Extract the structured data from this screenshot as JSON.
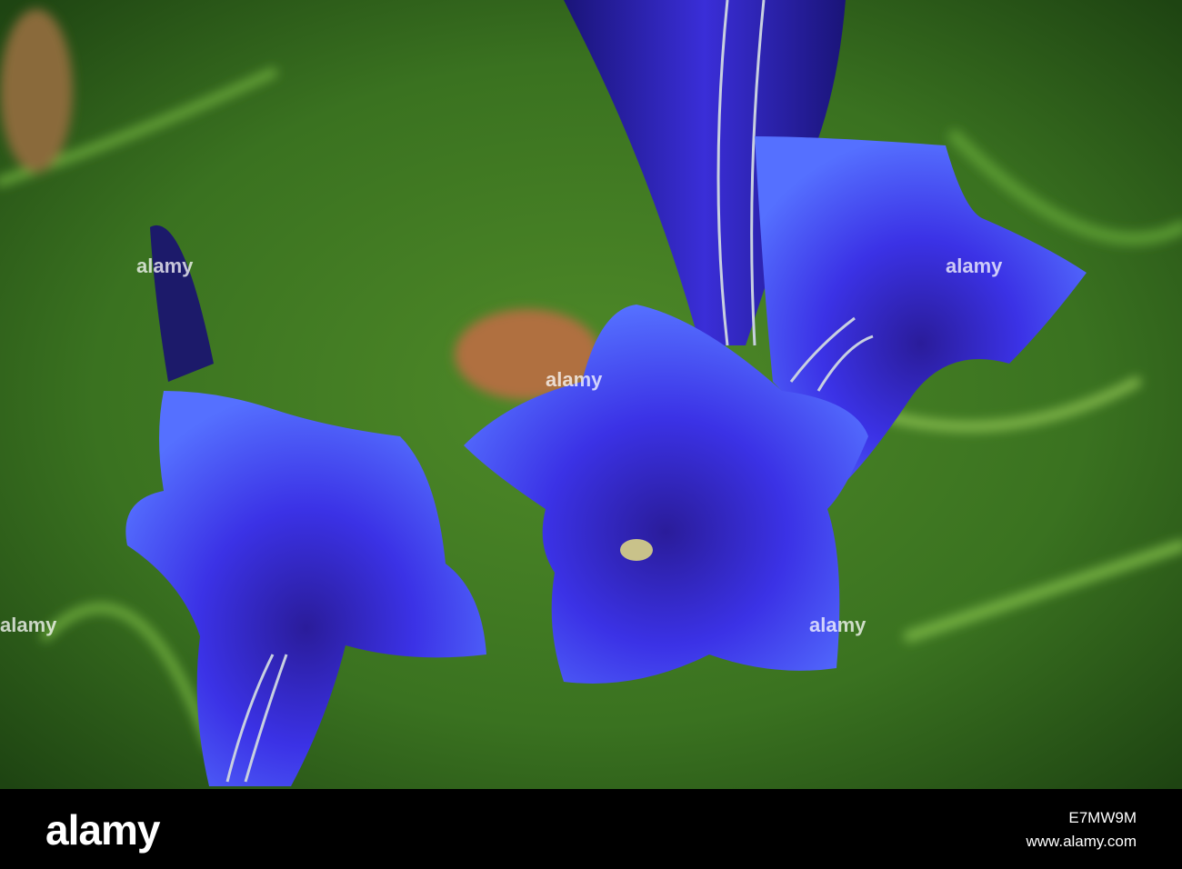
{
  "photo": {
    "subject": "blue gentian flowers in grass",
    "colors": {
      "grass": "#3f7a1e",
      "grass_dark": "#1f4a12",
      "petal": "#3a2ee0",
      "petal_light": "#5a6cff",
      "petal_dark": "#1a1490",
      "stripe": "#c8d0e0"
    }
  },
  "watermark": {
    "text": "alamy"
  },
  "footer": {
    "logo": "alamy",
    "image_id": "E7MW9M",
    "site": "www.alamy.com"
  }
}
